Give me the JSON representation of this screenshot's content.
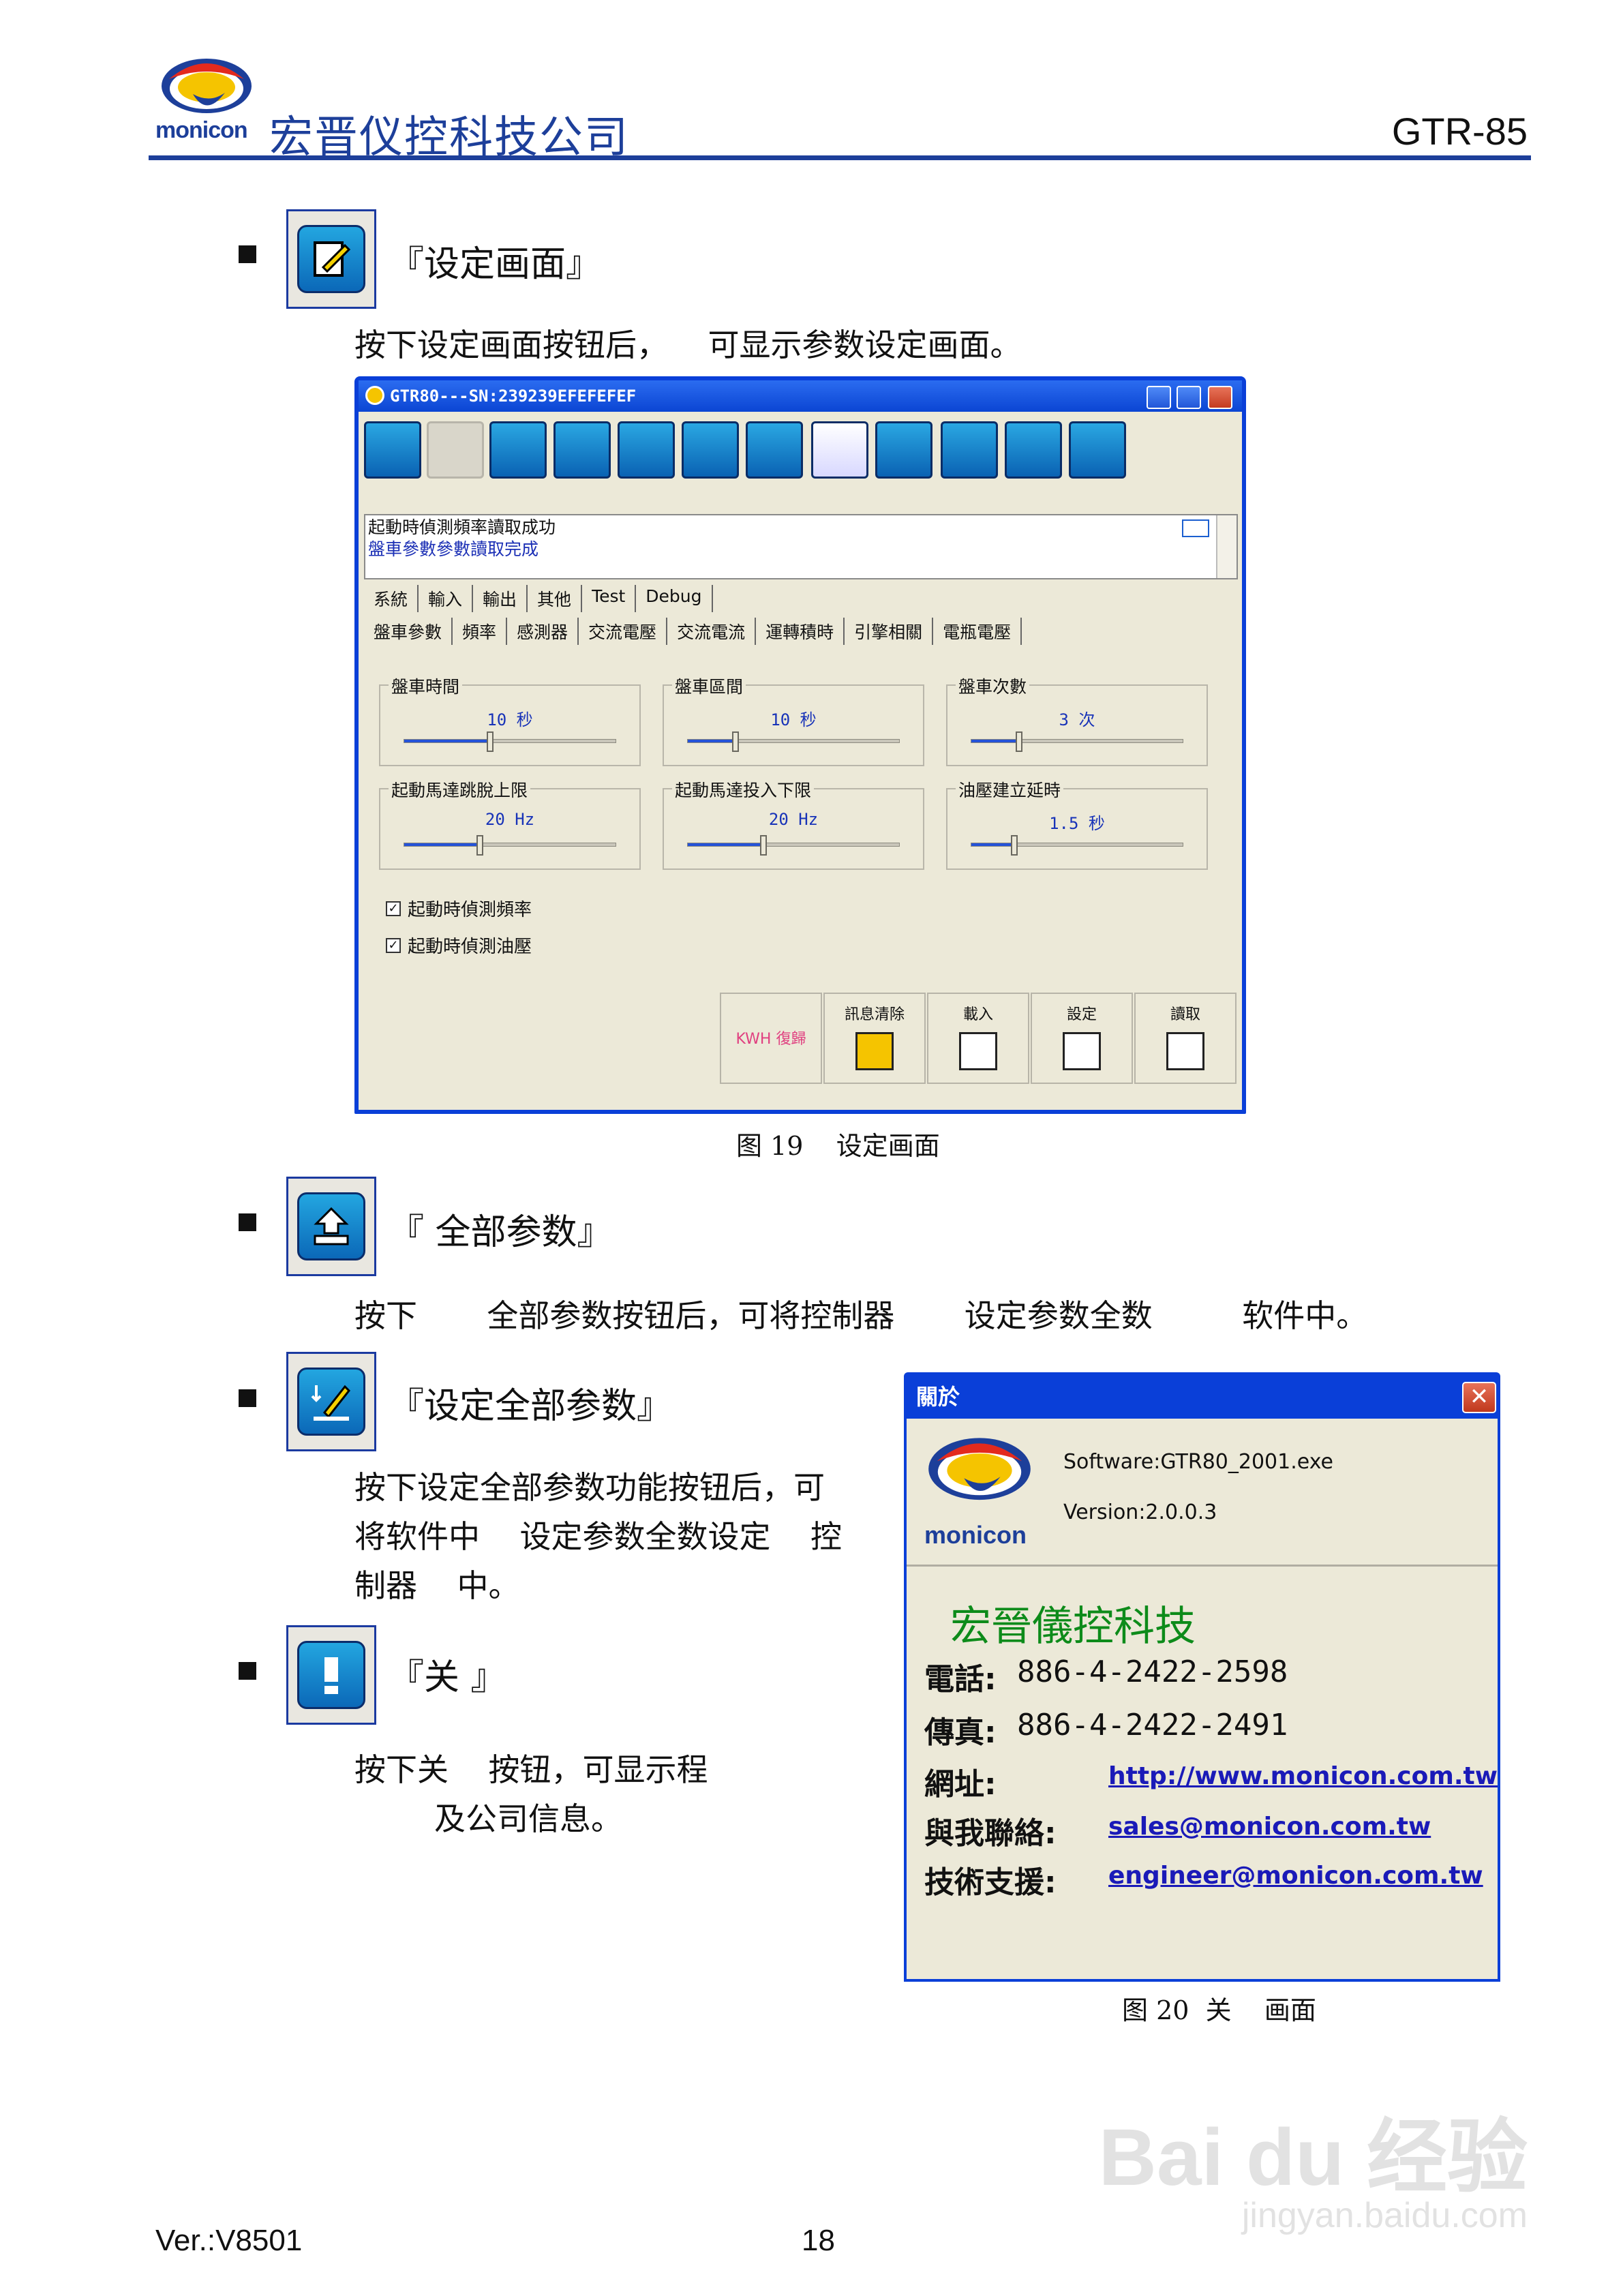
{
  "header": {
    "company": "宏晋仪控科技公司",
    "model": "GTR-85",
    "logo_text": "monicon"
  },
  "sections": {
    "setting": {
      "title": "『设定画面』",
      "desc": "按下设定画面按钮后，    可显示参数设定画面。"
    },
    "read_all": {
      "title": "『       全部参数』",
      "desc": "按下       全部参数按钮后，可将控制器       设定参数全数         软件中。"
    },
    "set_all": {
      "title": "『设定全部参数』",
      "desc_lines": [
        "按下设定全部参数功能按钮后，可",
        "将软件中    设定参数全数设定    控",
        "制器    中。"
      ]
    },
    "about": {
      "title": "『关    』",
      "desc_lines": [
        "按下关    按钮，可显示程",
        "        及公司信息。"
      ]
    }
  },
  "figure19": {
    "caption": "图 19    设定画面",
    "window_title": "GTR80---SN:239239EFEFEFEF",
    "messages": [
      "起動時偵測頻率讀取成功",
      "盤車參數參數讀取完成"
    ],
    "tabs_top": [
      "系統",
      "輸入",
      "輸出",
      "其他",
      "Test",
      "Debug"
    ],
    "tabs_sub": [
      "盤車參數",
      "頻率",
      "感測器",
      "交流電壓",
      "交流電流",
      "運轉積時",
      "引擎相關",
      "電瓶電壓"
    ],
    "groups": [
      {
        "label": "盤車時間",
        "value": "10 秒",
        "level": 0.4
      },
      {
        "label": "盤車區間",
        "value": "10 秒",
        "level": 0.22
      },
      {
        "label": "盤車次數",
        "value": "3 次",
        "level": 0.22
      },
      {
        "label": "起動馬達跳脫上限",
        "value": "20 Hz",
        "level": 0.35
      },
      {
        "label": "起動馬達投入下限",
        "value": "20 Hz",
        "level": 0.35
      },
      {
        "label": "油壓建立延時",
        "value": "1.5 秒",
        "level": 0.2
      }
    ],
    "checkboxes": [
      "起動時偵測頻率",
      "起動時偵測油壓"
    ],
    "buttons": [
      "KWH 復歸",
      "訊息清除",
      "載入",
      "設定",
      "讀取"
    ]
  },
  "figure20": {
    "caption": "图 20  关    画面",
    "dialog_title": "關於",
    "software": "Software:GTR80_2001.exe",
    "version": "Version:2.0.0.3",
    "company": "宏晉儀控科技",
    "phone_label": "電話:",
    "phone": "886-4-2422-2598",
    "fax_label": "傳真:",
    "fax": "886-4-2422-2491",
    "web_label": "網址:",
    "web": "http://www.monicon.com.tw",
    "contact_label": "與我聯絡:",
    "contact": "sales@monicon.com.tw",
    "support_label": "技術支援:",
    "support": "engineer@monicon.com.tw",
    "logo_text": "monicon"
  },
  "footer": {
    "version": "Ver.:V8501",
    "page": "18"
  },
  "watermark": {
    "brand": "Bai du 经验",
    "url": "jingyan.baidu.com"
  }
}
